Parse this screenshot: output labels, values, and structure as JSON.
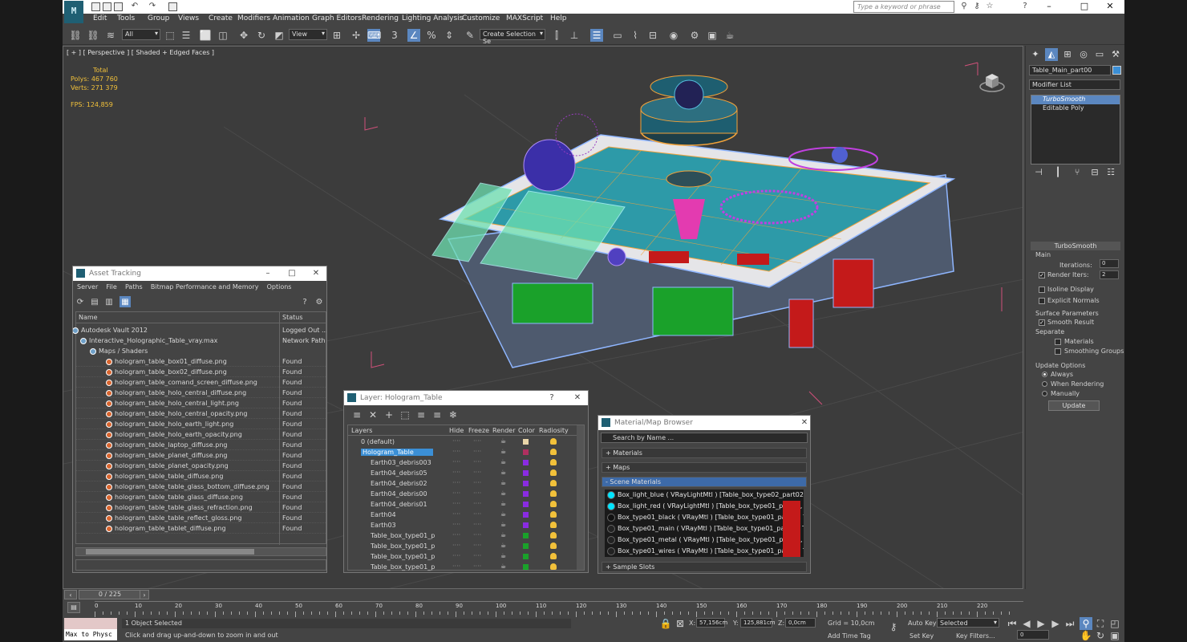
{
  "titlebar": {
    "search_placeholder": "Type a keyword or phrase"
  },
  "menu": {
    "items": [
      "Edit",
      "Tools",
      "Group",
      "Views",
      "Create",
      "Modifiers",
      "Animation",
      "Graph Editors",
      "Rendering",
      "Lighting Analysis",
      "Customize",
      "MAXScript",
      "Help"
    ]
  },
  "toolbar": {
    "selection_filter": "All",
    "ref_coord": "View",
    "named_selection": "Create Selection Se"
  },
  "viewport": {
    "label": "[ + ] [ Perspective ] [ Shaded + Edged Faces ]",
    "stats": {
      "total": "Total",
      "polys_label": "Polys:",
      "polys": "467 760",
      "verts_label": "Verts:",
      "verts": "271 379",
      "fps_label": "FPS:",
      "fps": "124,859"
    }
  },
  "command_panel": {
    "object_name": "Table_Main_part00",
    "modifier_list": "Modifier List",
    "stack": [
      "TurboSmooth",
      "Editable Poly"
    ],
    "rollout_title": "TurboSmooth",
    "main_label": "Main",
    "iterations_label": "Iterations:",
    "iterations": "0",
    "render_iters_label": "Render Iters:",
    "render_iters": "2",
    "isoline": "Isoline Display",
    "explicit_normals": "Explicit Normals",
    "surface_params": "Surface Parameters",
    "smooth_result": "Smooth Result",
    "separate": "Separate",
    "materials": "Materials",
    "smoothing_groups": "Smoothing Groups",
    "update_options": "Update Options",
    "always": "Always",
    "when_rendering": "When Rendering",
    "manually": "Manually",
    "update_btn": "Update"
  },
  "asset_tracking": {
    "title": "Asset Tracking",
    "menu": [
      "Server",
      "File",
      "Paths",
      "Bitmap Performance and Memory",
      "Options"
    ],
    "col_name": "Name",
    "col_status": "Status",
    "rows": [
      {
        "name": "Autodesk Vault 2012",
        "status": "Logged Out ..."
      },
      {
        "name": "Interactive_Holographic_Table_vray.max",
        "status": "Network Path"
      },
      {
        "name": "Maps / Shaders",
        "status": ""
      },
      {
        "name": "hologram_table_box01_diffuse.png",
        "status": "Found"
      },
      {
        "name": "hologram_table_box02_diffuse.png",
        "status": "Found"
      },
      {
        "name": "hologram_table_comand_screen_diffuse.png",
        "status": "Found"
      },
      {
        "name": "hologram_table_holo_central_diffuse.png",
        "status": "Found"
      },
      {
        "name": "hologram_table_holo_central_light.png",
        "status": "Found"
      },
      {
        "name": "hologram_table_holo_central_opacity.png",
        "status": "Found"
      },
      {
        "name": "hologram_table_holo_earth_light.png",
        "status": "Found"
      },
      {
        "name": "hologram_table_holo_earth_opacity.png",
        "status": "Found"
      },
      {
        "name": "hologram_table_laptop_diffuse.png",
        "status": "Found"
      },
      {
        "name": "hologram_table_planet_diffuse.png",
        "status": "Found"
      },
      {
        "name": "hologram_table_planet_opacity.png",
        "status": "Found"
      },
      {
        "name": "hologram_table_table_diffuse.png",
        "status": "Found"
      },
      {
        "name": "hologram_table_table_glass_bottom_diffuse.png",
        "status": "Found"
      },
      {
        "name": "hologram_table_table_glass_diffuse.png",
        "status": "Found"
      },
      {
        "name": "hologram_table_table_glass_refraction.png",
        "status": "Found"
      },
      {
        "name": "hologram_table_table_reflect_gloss.png",
        "status": "Found"
      },
      {
        "name": "hologram_table_tablet_diffuse.png",
        "status": "Found"
      }
    ]
  },
  "layers": {
    "title": "Layer: Hologram_Table",
    "cols": [
      "Layers",
      "Hide",
      "Freeze",
      "Render",
      "Color",
      "Radiosity"
    ],
    "rows": [
      {
        "name": "0 (default)",
        "color": "#e8d5a8"
      },
      {
        "name": "Hologram_Table",
        "color": "#b03060"
      },
      {
        "name": "Earth03_debris003",
        "color": "#8a2be2"
      },
      {
        "name": "Earth04_debris05",
        "color": "#8a2be2"
      },
      {
        "name": "Earth04_debris02",
        "color": "#8a2be2"
      },
      {
        "name": "Earth04_debris00",
        "color": "#8a2be2"
      },
      {
        "name": "Earth04_debris01",
        "color": "#8a2be2"
      },
      {
        "name": "Earth04",
        "color": "#8a2be2"
      },
      {
        "name": "Earth03",
        "color": "#8a2be2"
      },
      {
        "name": "Table_box_type01_p",
        "color": "#1aa12a"
      },
      {
        "name": "Table_box_type01_p",
        "color": "#1aa12a"
      },
      {
        "name": "Table_box_type01_p",
        "color": "#1aa12a"
      },
      {
        "name": "Table_box_type01_p",
        "color": "#1aa12a"
      }
    ]
  },
  "materials": {
    "title": "Material/Map Browser",
    "search": "Search by Name ...",
    "sections": [
      "+ Materials",
      "+ Maps",
      "- Scene Materials",
      "+ Sample Slots"
    ],
    "rows": [
      {
        "text": "Box_light_blue  ( VRayLightMtl ) [Table_box_type02_part02, T...",
        "color": "#00e5ff"
      },
      {
        "text": "Box_light_red  ( VRayLightMtl ) [Table_box_type01_part05, Ta...",
        "color": "#00e5ff"
      },
      {
        "text": "Box_type01_black  ( VRayMtl ) [Table_box_type01_part02, Ta...",
        "color": "#111"
      },
      {
        "text": "Box_type01_main  ( VRayMtl ) [Table_box_type01_part00, Ta...",
        "color": "#222"
      },
      {
        "text": "Box_type01_metal  ( VRayMtl ) [Table_box_type01_part01, Ta...",
        "color": "#222"
      },
      {
        "text": "Box_type01_wires  ( VRayMtl ) [Table_box_type01_part04, Ta...",
        "color": "#222"
      }
    ]
  },
  "timeline": {
    "frame": "0 / 225",
    "ticks": [
      "0",
      "10",
      "20",
      "30",
      "40",
      "50",
      "60",
      "70",
      "80",
      "90",
      "100",
      "110",
      "120",
      "130",
      "140",
      "150",
      "160",
      "170",
      "180",
      "190",
      "200",
      "210",
      "220"
    ]
  },
  "status": {
    "maxscript": "Max to Physc",
    "selected": "1 Object Selected",
    "prompt": "Click and drag up-and-down to zoom in and out",
    "x_label": "X:",
    "x": "57,156cm",
    "y_label": "Y:",
    "y": "125,881cm",
    "z_label": "Z:",
    "z": "0,0cm",
    "grid": "Grid = 10,0cm",
    "auto_key": "Auto Key",
    "selected_dd": "Selected",
    "set_key": "Set Key",
    "key_filters": "Key Filters...",
    "add_time_tag": "Add Time Tag",
    "frame_field": "0"
  }
}
